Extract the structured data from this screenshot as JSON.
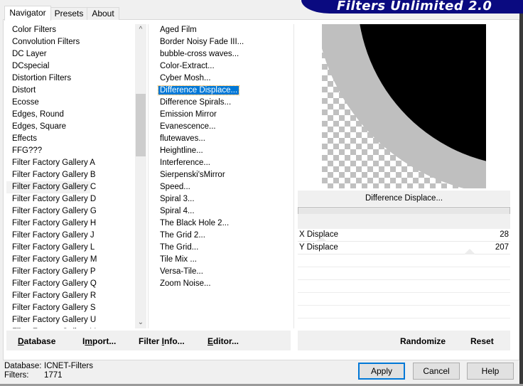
{
  "banner": {
    "title": "Filters Unlimited 2.0"
  },
  "tabs": [
    {
      "label": "Navigator",
      "active": true
    },
    {
      "label": "Presets",
      "active": false
    },
    {
      "label": "About",
      "active": false
    }
  ],
  "categories": {
    "items": [
      "Color Filters",
      "Convolution Filters",
      "DC Layer",
      "DCspecial",
      "Distortion Filters",
      "Distort",
      "Ecosse",
      "Edges, Round",
      "Edges, Square",
      "Effects",
      "FFG???",
      "Filter Factory Gallery A",
      "Filter Factory Gallery B",
      "Filter Factory Gallery C",
      "Filter Factory Gallery D",
      "Filter Factory Gallery G",
      "Filter Factory Gallery H",
      "Filter Factory Gallery J",
      "Filter Factory Gallery L",
      "Filter Factory Gallery M",
      "Filter Factory Gallery P",
      "Filter Factory Gallery Q",
      "Filter Factory Gallery R",
      "Filter Factory Gallery S",
      "Filter Factory Gallery U",
      "Filter Factory Gallery V"
    ],
    "highlighted": "Filter Factory Gallery C",
    "scroll_icons": {
      "up": "chevron-up-icon",
      "down": "chevron-down-icon"
    }
  },
  "filters": {
    "items": [
      "Aged Film",
      "Border Noisy Fade III...",
      "bubble-cross waves...",
      "Color-Extract...",
      "Cyber Mosh...",
      "Difference Displace...",
      "Difference Spirals...",
      "Emission Mirror",
      "Evanescence...",
      "flutewaves...",
      "Heightline...",
      "Interference...",
      "Sierpenski'sMirror",
      "Speed...",
      "Spiral 3...",
      "Spiral 4...",
      "The Black Hole 2...",
      "The Grid 2...",
      "The Grid...",
      "Tile Mix ...",
      "Versa-Tile...",
      "Zoom Noise..."
    ],
    "selected": "Difference Displace..."
  },
  "left_buttons": {
    "database": {
      "pre": "",
      "u": "D",
      "post": "atabase"
    },
    "import": {
      "pre": "I",
      "u": "m",
      "post": "port..."
    },
    "filter_info": {
      "pre": "Filter ",
      "u": "I",
      "post": "nfo..."
    },
    "editor": {
      "pre": "",
      "u": "E",
      "post": "ditor..."
    }
  },
  "preview": {
    "filter_name": "Difference Displace...",
    "progress": 0
  },
  "params": [
    {
      "label": "X Displace",
      "value": "28",
      "fraction": 0.11
    },
    {
      "label": "Y Displace",
      "value": "207",
      "fraction": 0.81
    }
  ],
  "right_buttons": {
    "randomize": "Randomize",
    "reset": "Reset"
  },
  "status": {
    "database_label": "Database:",
    "database_value": "ICNET-Filters",
    "filters_label": "Filters:",
    "filters_value": "1771"
  },
  "dialog_buttons": {
    "apply": "Apply",
    "cancel": "Cancel",
    "help": "Help"
  }
}
